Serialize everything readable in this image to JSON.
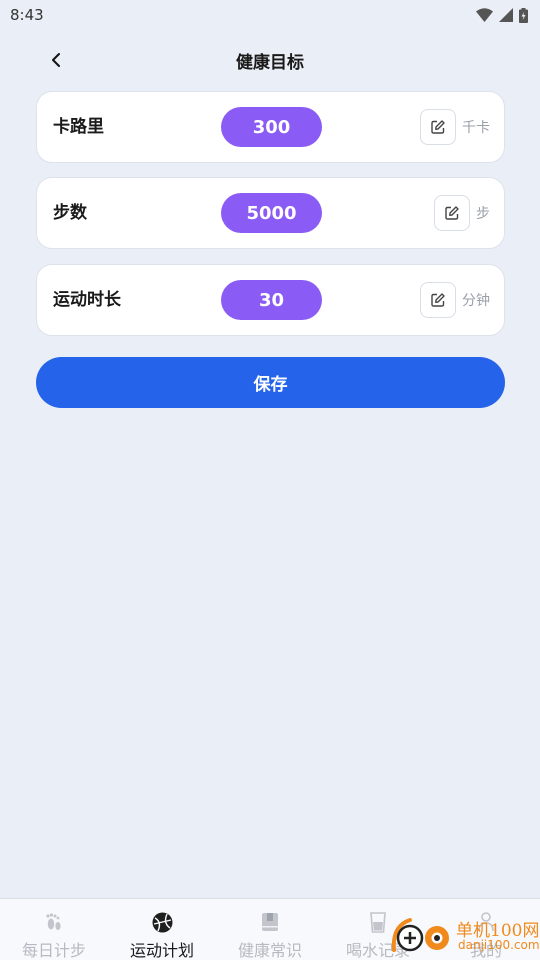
{
  "status_bar": {
    "time": "8:43"
  },
  "header": {
    "title": "健康目标"
  },
  "goals": [
    {
      "label": "卡路里",
      "value": "300",
      "unit": "千卡"
    },
    {
      "label": "步数",
      "value": "5000",
      "unit": "步"
    },
    {
      "label": "运动时长",
      "value": "30",
      "unit": "分钟"
    }
  ],
  "save_label": "保存",
  "nav": {
    "items": [
      {
        "label": "每日计步",
        "icon": "footprint-icon",
        "active": false
      },
      {
        "label": "运动计划",
        "icon": "basketball-icon",
        "active": true
      },
      {
        "label": "健康常识",
        "icon": "book-icon",
        "active": false
      },
      {
        "label": "喝水记录",
        "icon": "cup-icon",
        "active": false
      },
      {
        "label": "我的",
        "icon": "user-icon",
        "active": false
      }
    ]
  },
  "watermark": {
    "brand": "单机100网",
    "domain": "danji100.com"
  },
  "colors": {
    "background": "#eaeef6",
    "value_pill": "#8a5cf5",
    "primary": "#2563eb",
    "watermark": "#f08a1c"
  }
}
